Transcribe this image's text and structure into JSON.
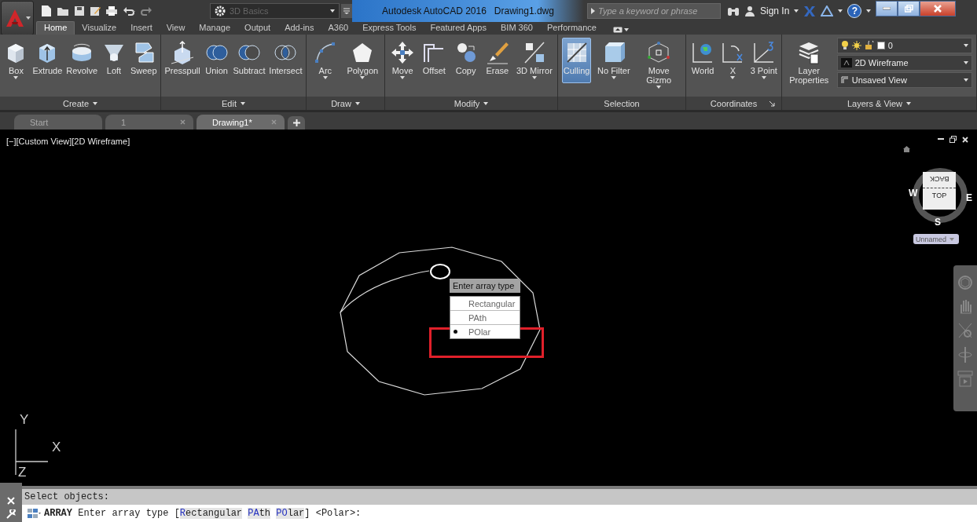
{
  "app": {
    "workspace": "3D Basics",
    "product": "Autodesk AutoCAD 2016",
    "file": "Drawing1.dwg",
    "search_placeholder": "Type a keyword or phrase",
    "sign_in": "Sign In",
    "help": "?"
  },
  "ribbon_tabs": [
    {
      "label": "Home",
      "selected": true
    },
    {
      "label": "Visualize",
      "selected": false
    },
    {
      "label": "Insert",
      "selected": false
    },
    {
      "label": "View",
      "selected": false
    },
    {
      "label": "Manage",
      "selected": false
    },
    {
      "label": "Output",
      "selected": false
    },
    {
      "label": "Add-ins",
      "selected": false
    },
    {
      "label": "A360",
      "selected": false
    },
    {
      "label": "Express Tools",
      "selected": false
    },
    {
      "label": "Featured Apps",
      "selected": false
    },
    {
      "label": "BIM 360",
      "selected": false
    },
    {
      "label": "Performance",
      "selected": false
    }
  ],
  "panels": [
    {
      "title": "Create",
      "dropdown": true,
      "launcher": false,
      "tools": [
        {
          "label": "Box",
          "dropdown": true,
          "selected": false
        },
        {
          "label": "Extrude",
          "dropdown": false,
          "selected": false
        },
        {
          "label": "Revolve",
          "dropdown": false,
          "selected": false
        },
        {
          "label": "Loft",
          "dropdown": false,
          "selected": false
        },
        {
          "label": "Sweep",
          "dropdown": false,
          "selected": false
        }
      ]
    },
    {
      "title": "Edit",
      "dropdown": true,
      "launcher": false,
      "tools": [
        {
          "label": "Presspull",
          "dropdown": false,
          "selected": false
        },
        {
          "label": "Union",
          "dropdown": false,
          "selected": false
        },
        {
          "label": "Subtract",
          "dropdown": false,
          "selected": false
        },
        {
          "label": "Intersect",
          "dropdown": false,
          "selected": false
        }
      ]
    },
    {
      "title": "Draw",
      "dropdown": true,
      "launcher": false,
      "tools": [
        {
          "label": "Arc",
          "dropdown": true,
          "selected": false
        },
        {
          "label": "Polygon",
          "dropdown": true,
          "selected": false
        }
      ]
    },
    {
      "title": "Modify",
      "dropdown": true,
      "launcher": false,
      "tools": [
        {
          "label": "Move",
          "dropdown": true,
          "selected": false
        },
        {
          "label": "Offset",
          "dropdown": false,
          "selected": false
        },
        {
          "label": "Copy",
          "dropdown": false,
          "selected": false
        },
        {
          "label": "Erase",
          "dropdown": false,
          "selected": false
        },
        {
          "label": "3D Mirror",
          "dropdown": true,
          "selected": false
        }
      ]
    },
    {
      "title": "Selection",
      "dropdown": false,
      "launcher": false,
      "tools": [
        {
          "label": "Culling",
          "dropdown": false,
          "selected": true
        },
        {
          "label": "No Filter",
          "dropdown": true,
          "selected": false
        },
        {
          "label": "Move Gizmo",
          "dropdown": true,
          "selected": false
        }
      ]
    },
    {
      "title": "Coordinates",
      "dropdown": false,
      "launcher": true,
      "tools": [
        {
          "label": "World",
          "dropdown": false,
          "selected": false
        },
        {
          "label": "X",
          "dropdown": true,
          "selected": false
        },
        {
          "label": "3 Point",
          "dropdown": true,
          "selected": false
        }
      ]
    },
    {
      "title": "Layers & View",
      "dropdown": true,
      "launcher": false,
      "tools": [
        {
          "label": "Layer Properties",
          "dropdown": false,
          "selected": false
        }
      ],
      "layer": "0",
      "visual_style": "2D Wireframe",
      "view": "Unsaved View"
    }
  ],
  "doc_tabs": [
    {
      "label": "Start",
      "selected": false,
      "closable": false
    },
    {
      "label": "1",
      "selected": false,
      "closable": true
    },
    {
      "label": "Drawing1*",
      "selected": true,
      "closable": true
    }
  ],
  "viewport": {
    "label": "[−][Custom View][2D Wireframe]",
    "viewcube": {
      "back": "BACK",
      "top": "TOP",
      "west": "W",
      "east": "E",
      "south": "S",
      "view_name": "Unnamed"
    }
  },
  "array_menu": {
    "title": "Enter array type",
    "options": [
      {
        "label": "Rectangular",
        "selected": false
      },
      {
        "label": "PAth",
        "selected": false
      },
      {
        "label": "POlar",
        "selected": true
      }
    ]
  },
  "ucs": {
    "x": "X",
    "y": "Y",
    "z": "Z"
  },
  "command_line": {
    "history": "Select objects:",
    "command": "ARRAY",
    "prompt": "Enter array type [",
    "options": [
      {
        "key": "R",
        "rest": "ectangular"
      },
      {
        "key": "PA",
        "rest": "th"
      },
      {
        "key": "PO",
        "rest": "lar"
      }
    ],
    "close": "]",
    "default": "<Polar>:"
  }
}
